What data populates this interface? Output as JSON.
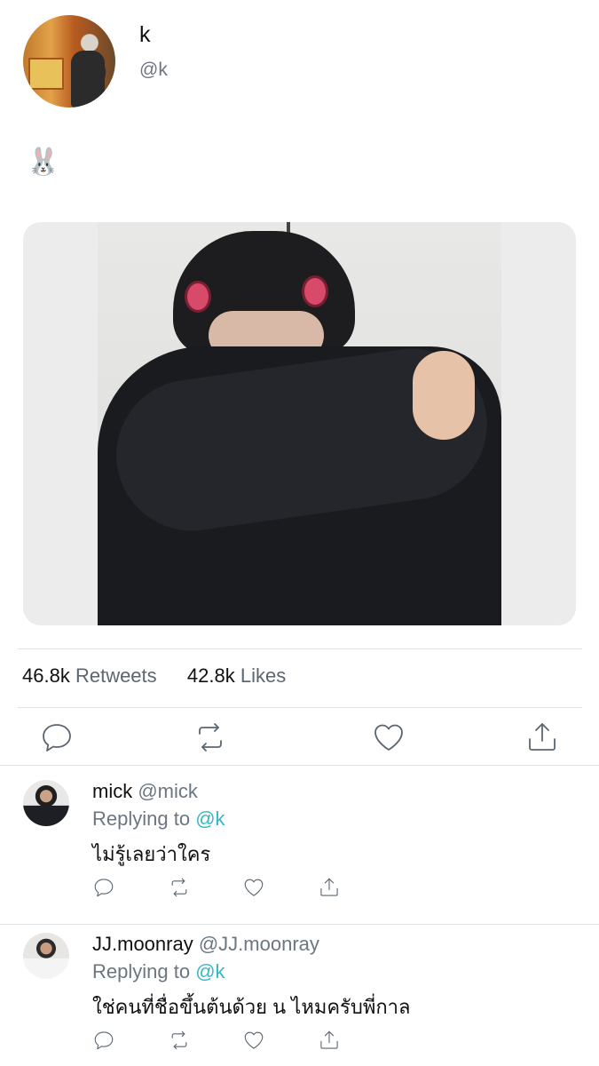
{
  "tweet": {
    "author_name": "k",
    "author_handle": "@k",
    "text": "🐰",
    "retweets_count": "46.8k",
    "retweets_label": "Retweets",
    "likes_count": "42.8k",
    "likes_label": "Likes"
  },
  "replies": [
    {
      "name": "mick",
      "handle": "@mick",
      "replying_prefix": "Replying to",
      "replying_to": "@k",
      "text": "ไม่รู้เลยว่าใคร"
    },
    {
      "name": "JJ.moonray",
      "handle": "@JJ.moonray",
      "replying_prefix": "Replying to",
      "replying_to": "@k",
      "text": "ใช่คนที่ชื่อขึ้นต้นด้วย น ไหมครับพี่กาล"
    }
  ],
  "icons": [
    "reply-icon",
    "retweet-icon",
    "like-icon",
    "share-icon"
  ],
  "colors": {
    "mention": "#35b8c4",
    "secondary_text": "#6b7680",
    "divider": "#dfe3e6"
  }
}
